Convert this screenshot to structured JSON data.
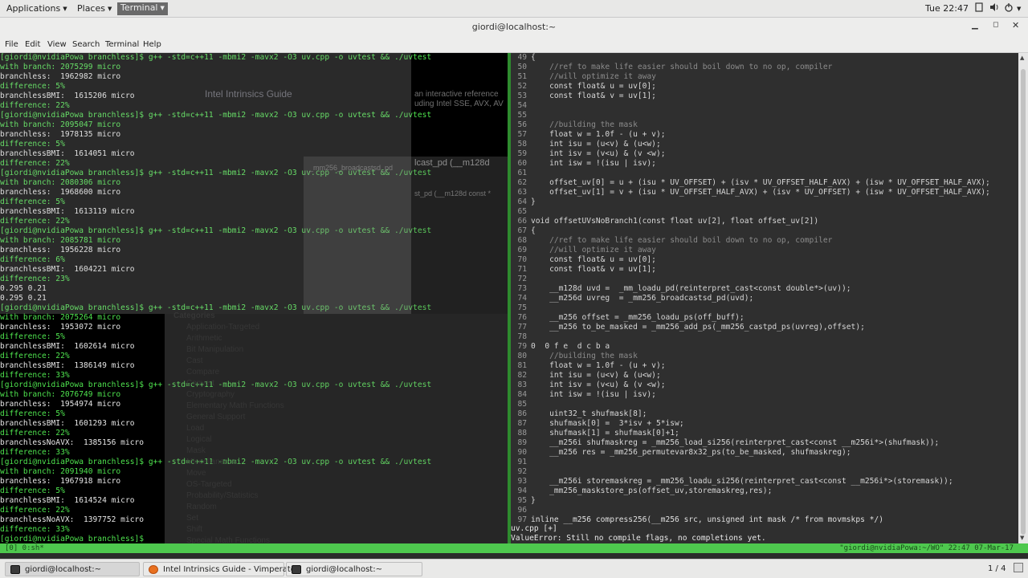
{
  "topbar": {
    "applications": "Applications",
    "places": "Places",
    "terminal": "Terminal",
    "clock": "Tue 22:47"
  },
  "window": {
    "title": "giordi@localhost:~"
  },
  "menu": [
    "File",
    "Edit",
    "View",
    "Search",
    "Terminal",
    "Help"
  ],
  "left_lines": [
    {
      "t": "[giordi@nvidiaPowa branchless]$ g++ -std=c++11 -mbmi2 -mavx2 -O3 uv.cpp -o uvtest && ./uvtest",
      "c": "grn"
    },
    {
      "t": "with branch: 2075299 micro",
      "c": "grn"
    },
    {
      "t": "branchless:  1962982 micro",
      "c": "wht"
    },
    {
      "t": "difference: 5%",
      "c": "grn"
    },
    {
      "t": "branchlessBMI:  1615206 micro",
      "c": "wht"
    },
    {
      "t": "difference: 22%",
      "c": "grn"
    },
    {
      "t": "[giordi@nvidiaPowa branchless]$ g++ -std=c++11 -mbmi2 -mavx2 -O3 uv.cpp -o uvtest && ./uvtest",
      "c": "grn"
    },
    {
      "t": "with branch: 2095047 micro",
      "c": "grn"
    },
    {
      "t": "branchless:  1978135 micro",
      "c": "wht"
    },
    {
      "t": "difference: 5%",
      "c": "grn"
    },
    {
      "t": "branchlessBMI:  1614051 micro",
      "c": "wht"
    },
    {
      "t": "difference: 22%",
      "c": "grn"
    },
    {
      "t": "[giordi@nvidiaPowa branchless]$ g++ -std=c++11 -mbmi2 -mavx2 -O3 uv.cpp -o uvtest && ./uvtest",
      "c": "grn"
    },
    {
      "t": "with branch: 2080306 micro",
      "c": "grn"
    },
    {
      "t": "branchless:  1968600 micro",
      "c": "wht"
    },
    {
      "t": "difference: 5%",
      "c": "grn"
    },
    {
      "t": "branchlessBMI:  1613119 micro",
      "c": "wht"
    },
    {
      "t": "difference: 22%",
      "c": "grn"
    },
    {
      "t": "[giordi@nvidiaPowa branchless]$ g++ -std=c++11 -mbmi2 -mavx2 -O3 uv.cpp -o uvtest && ./uvtest",
      "c": "grn"
    },
    {
      "t": "with branch: 2085781 micro",
      "c": "grn"
    },
    {
      "t": "branchless:  1956228 micro",
      "c": "wht"
    },
    {
      "t": "difference: 6%",
      "c": "grn"
    },
    {
      "t": "branchlessBMI:  1604221 micro",
      "c": "wht"
    },
    {
      "t": "difference: 23%",
      "c": "grn"
    },
    {
      "t": "0.295 0.21",
      "c": "wht"
    },
    {
      "t": "0.295 0.21",
      "c": "wht"
    },
    {
      "t": "[giordi@nvidiaPowa branchless]$ g++ -std=c++11 -mbmi2 -mavx2 -O3 uv.cpp -o uvtest && ./uvtest",
      "c": "grn"
    },
    {
      "t": "with branch: 2075264 micro",
      "c": "grn"
    },
    {
      "t": "branchless:  1953072 micro",
      "c": "wht"
    },
    {
      "t": "difference: 5%",
      "c": "grn"
    },
    {
      "t": "branchlessBMI:  1602614 micro",
      "c": "wht"
    },
    {
      "t": "difference: 22%",
      "c": "grn"
    },
    {
      "t": "branchlessBMI:  1386149 micro",
      "c": "wht"
    },
    {
      "t": "difference: 33%",
      "c": "grn"
    },
    {
      "t": "[giordi@nvidiaPowa branchless]$ g++ -std=c++11 -mbmi2 -mavx2 -O3 uv.cpp -o uvtest && ./uvtest",
      "c": "grn"
    },
    {
      "t": "with branch: 2076749 micro",
      "c": "grn"
    },
    {
      "t": "branchless:  1954974 micro",
      "c": "wht"
    },
    {
      "t": "difference: 5%",
      "c": "grn"
    },
    {
      "t": "branchlessBMI:  1601293 micro",
      "c": "wht"
    },
    {
      "t": "difference: 22%",
      "c": "grn"
    },
    {
      "t": "branchlessNoAVX:  1385156 micro",
      "c": "wht"
    },
    {
      "t": "difference: 33%",
      "c": "grn"
    },
    {
      "t": "[giordi@nvidiaPowa branchless]$ g++ -std=c++11 -mbmi2 -mavx2 -O3 uv.cpp -o uvtest && ./uvtest",
      "c": "grn"
    },
    {
      "t": "with branch: 2091940 micro",
      "c": "grn"
    },
    {
      "t": "branchless:  1967918 micro",
      "c": "wht"
    },
    {
      "t": "difference: 5%",
      "c": "grn"
    },
    {
      "t": "branchlessBMI:  1614524 micro",
      "c": "wht"
    },
    {
      "t": "difference: 22%",
      "c": "grn"
    },
    {
      "t": "branchlessNoAVX:  1397752 micro",
      "c": "wht"
    },
    {
      "t": "difference: 33%",
      "c": "grn"
    },
    {
      "t": "[giordi@nvidiaPowa branchless]$ ",
      "c": "grn"
    }
  ],
  "right_lines": [
    {
      "n": "49",
      "t": "{"
    },
    {
      "n": "50",
      "t": "    //ref to make life easier should boil down to no op, compiler"
    },
    {
      "n": "51",
      "t": "    //will optimize it away"
    },
    {
      "n": "52",
      "t": "    const float& u = uv[0];"
    },
    {
      "n": "53",
      "t": "    const float& v = uv[1];"
    },
    {
      "n": "54",
      "t": ""
    },
    {
      "n": "55",
      "t": ""
    },
    {
      "n": "56",
      "t": "    //building the mask"
    },
    {
      "n": "57",
      "t": "    float w = 1.0f - (u + v);"
    },
    {
      "n": "58",
      "t": "    int isu = (u<v) & (u<w);"
    },
    {
      "n": "59",
      "t": "    int isv = (v<u) & (v <w);"
    },
    {
      "n": "60",
      "t": "    int isw = !(isu | isv);"
    },
    {
      "n": "61",
      "t": ""
    },
    {
      "n": "62",
      "t": "    offset_uv[0] = u + (isu * UV_OFFSET) + (isv * UV_OFFSET_HALF_AVX) + (isw * UV_OFFSET_HALF_AVX);"
    },
    {
      "n": "63",
      "t": "    offset_uv[1] = v + (isu * UV_OFFSET_HALF_AVX) + (isv * UV_OFFSET) + (isw * UV_OFFSET_HALF_AVX);"
    },
    {
      "n": "64",
      "t": "}"
    },
    {
      "n": "65",
      "t": ""
    },
    {
      "n": "66",
      "t": "void offsetUVsNoBranch1(const float uv[2], float offset_uv[2])"
    },
    {
      "n": "67",
      "t": "{"
    },
    {
      "n": "68",
      "t": "    //ref to make life easier should boil down to no op, compiler"
    },
    {
      "n": "69",
      "t": "    //will optimize it away"
    },
    {
      "n": "70",
      "t": "    const float& u = uv[0];"
    },
    {
      "n": "71",
      "t": "    const float& v = uv[1];"
    },
    {
      "n": "72",
      "t": ""
    },
    {
      "n": "73",
      "t": "    __m128d uvd =  _mm_loadu_pd(reinterpret_cast<const double*>(uv));"
    },
    {
      "n": "74",
      "t": "    __m256d uvreg  = _mm256_broadcastsd_pd(uvd);"
    },
    {
      "n": "75",
      "t": ""
    },
    {
      "n": "76",
      "t": "    __m256 offset = _mm256_loadu_ps(off_buff);"
    },
    {
      "n": "77",
      "t": "    __m256 to_be_masked = _mm256_add_ps(_mm256_castpd_ps(uvreg),offset);"
    },
    {
      "n": "78",
      "t": ""
    },
    {
      "n": "79",
      "t": "0  0 f e  d c b a"
    },
    {
      "n": "80",
      "t": "    //building the mask"
    },
    {
      "n": "81",
      "t": "    float w = 1.0f - (u + v);"
    },
    {
      "n": "82",
      "t": "    int isu = (u<v) & (u<w);"
    },
    {
      "n": "83",
      "t": "    int isv = (v<u) & (v <w);"
    },
    {
      "n": "84",
      "t": "    int isw = !(isu | isv);"
    },
    {
      "n": "85",
      "t": ""
    },
    {
      "n": "86",
      "t": "    uint32_t shufmask[8];"
    },
    {
      "n": "87",
      "t": "    shufmask[0] =  3*isv + 5*isw;"
    },
    {
      "n": "88",
      "t": "    shufmask[1] = shufmask[0]+1;"
    },
    {
      "n": "89",
      "t": "    __m256i shufmaskreg = _mm256_load_si256(reinterpret_cast<const __m256i*>(shufmask));"
    },
    {
      "n": "90",
      "t": "    __m256 res = _mm256_permutevar8x32_ps(to_be_masked, shufmaskreg);"
    },
    {
      "n": "91",
      "t": ""
    },
    {
      "n": "92",
      "t": ""
    },
    {
      "n": "93",
      "t": "    __m256i storemaskreg = _mm256_loadu_si256(reinterpret_cast<const __m256i*>(storemask));"
    },
    {
      "n": "94",
      "t": "    _mm256_maskstore_ps(offset_uv,storemaskreg,res);"
    },
    {
      "n": "95",
      "t": "}"
    },
    {
      "n": "96",
      "t": ""
    },
    {
      "n": "97",
      "t": "inline __m256 compress256(__m256 src, unsigned int mask /* from movmskps */)"
    }
  ],
  "vim_status": "uv.cpp [+]",
  "vim_error": "ValueError: Still no compile flags, no completions yet.",
  "tmux": {
    "left": "[0] 0:sh*",
    "right": "\"giordi@nvidiaPowa:~/WO\" 22:47 07-Mar-17"
  },
  "ghost": {
    "header": "Intel Intrinsics Guide",
    "intro1": "an interactive reference",
    "intro2": "uding Intel SSE, AVX, AV",
    "func1": "lcast_pd (__m128d",
    "func2": "st_pd (__m128d const *",
    "func3": "_mm256_broadcastsd_pd",
    "categories_title": "Categories",
    "categories": [
      "Application-Targeted",
      "Arithmetic",
      "Bit Manipulation",
      "Cast",
      "Compare",
      "Convert",
      "Cryptography",
      "Elementary Math Functions",
      "General Support",
      "Load",
      "Logical",
      "Mask",
      "Miscellaneous",
      "Move",
      "OS-Targeted",
      "Probability/Statistics",
      "Random",
      "Set",
      "Shift",
      "Special Math Functions"
    ]
  },
  "taskbar": {
    "items": [
      "giordi@localhost:~",
      "Intel Intrinsics Guide - Vimperator",
      "giordi@localhost:~"
    ],
    "pager": "1 / 4"
  }
}
